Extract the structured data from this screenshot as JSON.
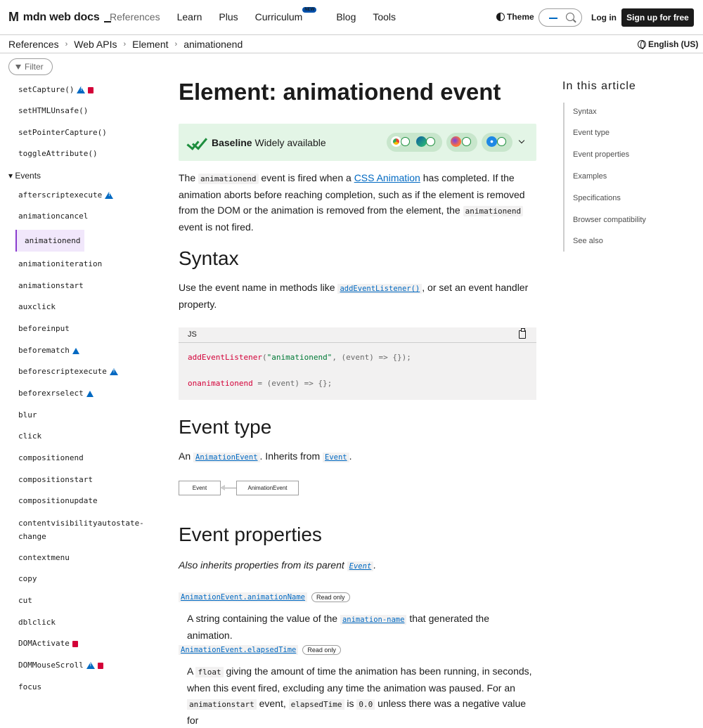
{
  "header": {
    "logo_text": "mdn web docs",
    "nav": [
      "References",
      "Learn",
      "Plus",
      "Curriculum",
      "Blog",
      "Tools"
    ],
    "new_badge": "NEW",
    "theme_label": "Theme",
    "login_label": "Log in",
    "signup_label": "Sign up for free"
  },
  "breadcrumb": [
    "References",
    "Web APIs",
    "Element",
    "animationend"
  ],
  "language": "English (US)",
  "sidebar": {
    "filter_label": "Filter",
    "methods": [
      "setCapture()",
      "setHTMLUnsafe()",
      "setPointerCapture()",
      "toggleAttribute()"
    ],
    "events_heading": "Events",
    "events": [
      "afterscriptexecute",
      "animationcancel",
      "animationend",
      "animationiteration",
      "animationstart",
      "auxclick",
      "beforeinput",
      "beforematch",
      "beforescriptexecute",
      "beforexrselect",
      "blur",
      "click",
      "compositionend",
      "compositionstart",
      "compositionupdate",
      "contentvisibilityautostate-change",
      "contextmenu",
      "copy",
      "cut",
      "dblclick",
      "DOMActivate",
      "DOMMouseScroll",
      "focus"
    ]
  },
  "article": {
    "title": "Element: animationend event",
    "baseline_bold": "Baseline",
    "baseline_rest": "Widely available",
    "intro": {
      "p1": "The",
      "code1": "animationend",
      "p2": "event is fired when a",
      "link": "CSS Animation",
      "p3": "has completed. If the animation aborts before reaching completion, such as if the element is removed from the DOM or the animation is removed from the element, the",
      "code2": "animationend",
      "p4": "event is not fired."
    },
    "syntax_heading": "Syntax",
    "syntax_text1": "Use the event name in methods like",
    "syntax_link": "addEventListener()",
    "syntax_text2": ", or set an event handler property.",
    "code_lang": "JS",
    "code_line1_fn": "addEventListener",
    "code_line1_str": "\"animationend\"",
    "code_line1_rest": ", (event) => {});",
    "code_line2_fn": "onanimationend",
    "code_line2_rest": " = (event) => {};",
    "event_type_heading": "Event type",
    "event_type_text1": "An",
    "event_type_link1": "AnimationEvent",
    "event_type_text2": ". Inherits from",
    "event_type_link2": "Event",
    "event_type_text3": ".",
    "inherit_diagram": [
      "Event",
      "AnimationEvent"
    ],
    "props_heading": "Event properties",
    "props_inherit_text": "Also inherits properties from its parent",
    "props_inherit_link": "Event",
    "props": [
      {
        "name": "AnimationEvent.animationName",
        "badge": "Read only",
        "desc_pre": "A string containing the value of the",
        "desc_link": "animation-name",
        "desc_post": "that generated the animation."
      },
      {
        "name": "AnimationEvent.elapsedTime",
        "badge": "Read only",
        "desc_pre": "A",
        "desc_code": "float",
        "desc_post": "giving the amount of time the animation has been running, in seconds, when this event fired, excluding any time the animation was paused. For an",
        "desc_code2": "animationstart",
        "desc_post2": "event,",
        "desc_code3": "elapsedTime",
        "desc_post3": "is",
        "desc_code4": "0.0",
        "desc_post4": "unless there was a negative value for"
      }
    ]
  },
  "toc": {
    "title": "In this article",
    "items": [
      "Syntax",
      "Event type",
      "Event properties",
      "Examples",
      "Specifications",
      "Browser compatibility",
      "See also"
    ]
  }
}
